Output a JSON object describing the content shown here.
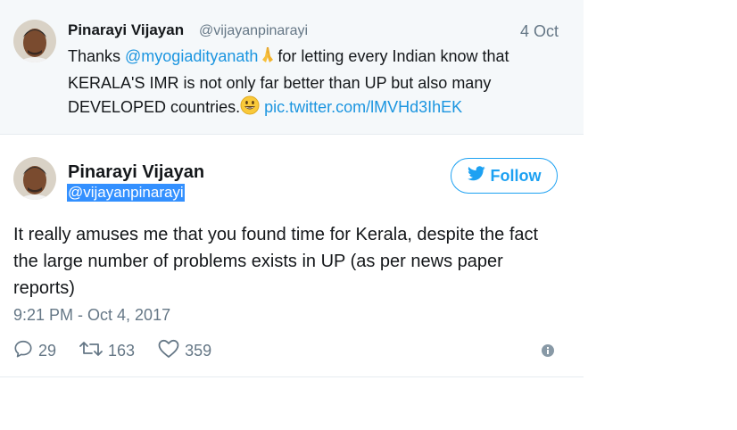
{
  "quoted_tweet": {
    "name": "Pinarayi Vijayan",
    "handle": "@vijayanpinarayi",
    "date": "4 Oct",
    "text_1": "Thanks ",
    "mention": "@myogiadityanath",
    "text_2": "for letting every Indian know that KERALA'S IMR is not only far better than UP but also many DEVELOPED countries.",
    "link": "pic.twitter.com/lMVHd3IhEK",
    "emoji_1": "folded-hands-emoji",
    "emoji_2": "smiling-face-emoji"
  },
  "tweet": {
    "name": "Pinarayi Vijayan",
    "handle": "@vijayanpinarayi",
    "follow_label": "Follow",
    "text": "It really amuses me that you found time for Kerala, despite the fact the large number of problems exists in UP (as per news paper reports)",
    "timestamp": "9:21 PM - Oct 4, 2017",
    "replies": "29",
    "retweets": "163",
    "likes": "359"
  },
  "colors": {
    "accent": "#1da1f2",
    "muted": "#657786",
    "quoted_bg": "#f5f8fa",
    "selection": "#3390ff"
  }
}
